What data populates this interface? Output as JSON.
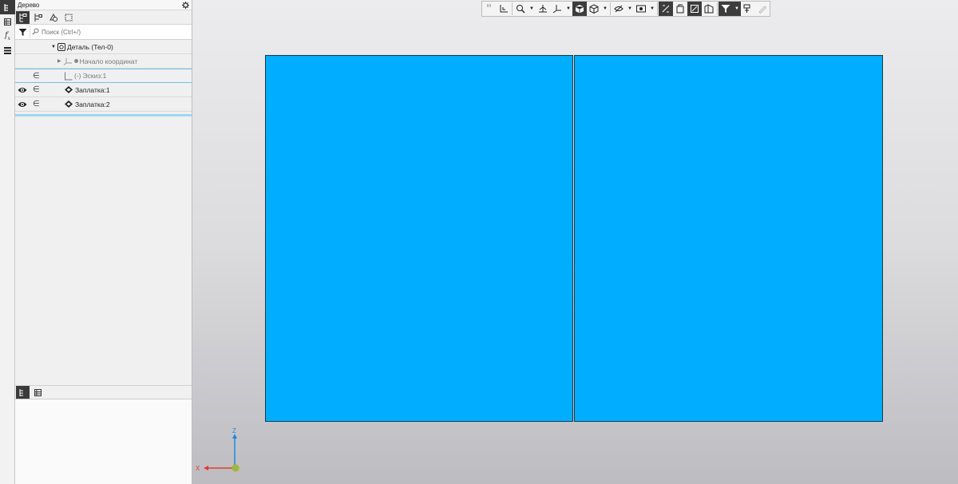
{
  "panel": {
    "title": "Дерево",
    "search_placeholder": "Поиск (Ctrl+/)"
  },
  "tree": {
    "items": [
      {
        "label": "Деталь (Тел-0)"
      },
      {
        "label": "Начало координат"
      },
      {
        "label": "Эскиз:1",
        "prefix": "(-)"
      },
      {
        "label": "Заплатка:1"
      },
      {
        "label": "Заплатка:2"
      }
    ]
  },
  "triad": {
    "x": "X",
    "z": "Z"
  },
  "colors": {
    "surface": "#00adff",
    "toolbar_active": "#3a3a3a",
    "selection": "#6fc5e3",
    "axis_x": "#e53935",
    "axis_z": "#1e88e5",
    "origin": "#8bc34a"
  },
  "icons": [
    "tree-icon",
    "table-icon",
    "fx-icon",
    "menu-icon",
    "gear-icon",
    "filter-icon",
    "search-icon",
    "eye-icon",
    "in-icon",
    "patch-icon",
    "sketch-icon",
    "part-icon"
  ]
}
